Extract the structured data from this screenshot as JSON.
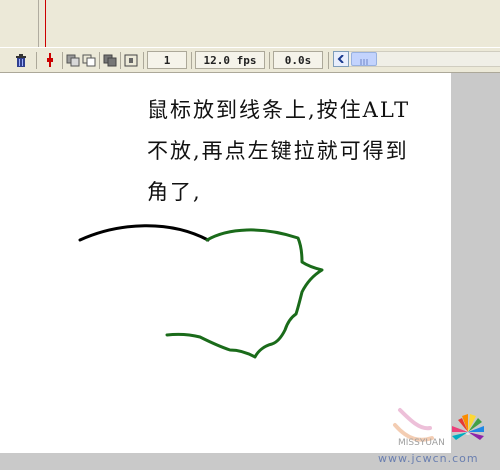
{
  "toolbar": {
    "frame": "1",
    "fps": "12.0 fps",
    "time": "0.0s",
    "icons": [
      "trash-icon",
      "onion-skin-icon",
      "onion-skin-outlines-icon",
      "edit-multiple-frames-icon",
      "modify-markers-icon",
      "scroll-left-icon"
    ]
  },
  "stage": {
    "caption_lines": [
      "鼠标放到线条上,按住ALT",
      "不放,再点左键拉就可得到",
      "角了,"
    ]
  },
  "colors": {
    "black_stroke": "#000000",
    "green_stroke": "#1a6b1a",
    "stage": "#ffffff",
    "workspace": "#c9c9c9"
  },
  "watermark": {
    "site": "www.jcwcn.com",
    "sub": "MISSYUAN"
  }
}
